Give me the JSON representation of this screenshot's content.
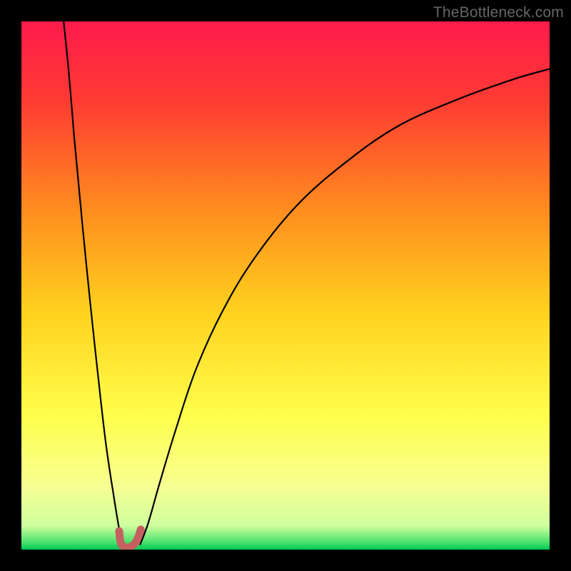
{
  "watermark": "TheBottleneck.com",
  "chart_data": {
    "type": "line",
    "title": "",
    "xlabel": "",
    "ylabel": "",
    "xlim": [
      0,
      100
    ],
    "ylim": [
      0,
      100
    ],
    "grid": false,
    "legend": false,
    "background_gradient_stops": [
      {
        "offset": 0.0,
        "color": "#FF1A4B"
      },
      {
        "offset": 0.15,
        "color": "#FF3B33"
      },
      {
        "offset": 0.35,
        "color": "#FF8A1F"
      },
      {
        "offset": 0.55,
        "color": "#FFD21E"
      },
      {
        "offset": 0.75,
        "color": "#FFFF4D"
      },
      {
        "offset": 0.88,
        "color": "#F6FF91"
      },
      {
        "offset": 0.955,
        "color": "#CFFF9E"
      },
      {
        "offset": 0.985,
        "color": "#4FE36E"
      },
      {
        "offset": 1.0,
        "color": "#00C853"
      }
    ],
    "series": [
      {
        "name": "left-branch",
        "x": [
          8.0,
          9.0,
          10.0,
          11.5,
          13.0,
          14.5,
          16.0,
          17.5,
          18.5,
          19.3
        ],
        "y": [
          100,
          90,
          78,
          62,
          47,
          33,
          20,
          10,
          4,
          1
        ]
      },
      {
        "name": "right-branch",
        "x": [
          22.5,
          24,
          26,
          29,
          33,
          38,
          44,
          52,
          61,
          71,
          82,
          93,
          100
        ],
        "y": [
          1,
          5,
          12,
          22,
          34,
          45,
          55,
          65,
          73,
          80,
          85,
          89,
          91
        ]
      },
      {
        "name": "bottom-nub",
        "x": [
          18.5,
          18.8,
          19.3,
          20.0,
          20.8,
          21.6,
          22.2,
          22.6
        ],
        "y": [
          3.5,
          1.3,
          0.6,
          0.4,
          0.6,
          1.3,
          2.6,
          3.8
        ]
      }
    ],
    "nub_color": "#C4615E",
    "curve_color": "#000000"
  }
}
